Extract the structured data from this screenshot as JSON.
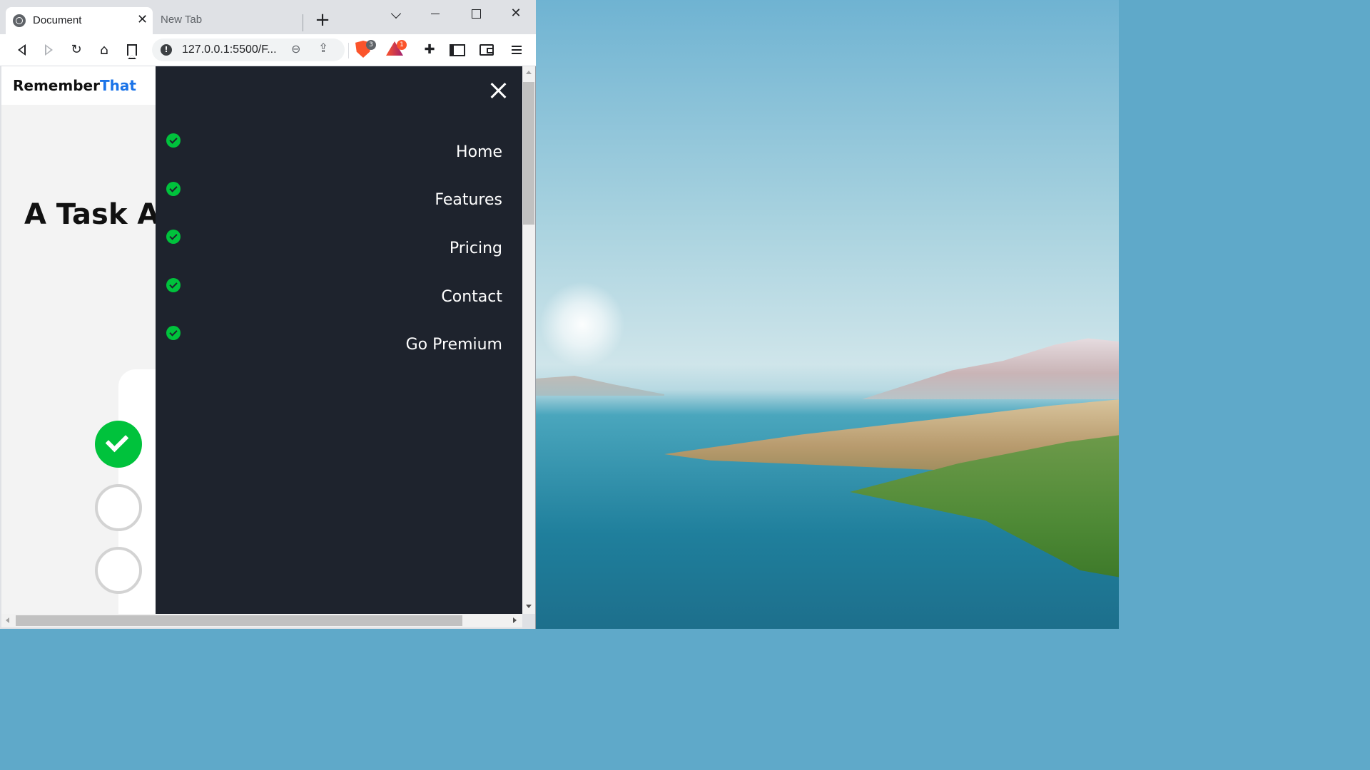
{
  "browser": {
    "tabs": [
      {
        "title": "Document",
        "active": true
      },
      {
        "title": "New Tab",
        "active": false
      }
    ],
    "close_tab_glyph": "✕",
    "new_tab_glyph": "+",
    "url": "127.0.0.1:5500/F...",
    "info_glyph": "!",
    "shields_badge": "3",
    "rewards_badge": "1",
    "window_close_glyph": "✕"
  },
  "page": {
    "logo_prefix": "Remember",
    "logo_accent": "That",
    "hero_title": "A Task A",
    "steps": [
      {
        "state": "done"
      },
      {
        "state": "todo"
      },
      {
        "state": "todo"
      }
    ],
    "nav": {
      "items": [
        {
          "label": "Home"
        },
        {
          "label": "Features"
        },
        {
          "label": "Pricing"
        },
        {
          "label": "Contact"
        },
        {
          "label": "Go Premium"
        }
      ]
    }
  },
  "colors": {
    "accent_blue": "#1a73e8",
    "check_green": "#00c23c",
    "nav_bg": "#1e232d",
    "brave_orange": "#fb542b"
  },
  "icons": {
    "tab_favicon": "globe-icon",
    "back": "back-arrow-icon",
    "forward": "forward-arrow-icon",
    "reload": "reload-icon",
    "home": "home-icon",
    "bookmark": "bookmark-icon",
    "site_info": "info-icon",
    "zoom": "zoom-out-icon",
    "share": "share-icon",
    "shields": "brave-shields-icon",
    "rewards": "brave-rewards-icon",
    "extensions": "puzzle-icon",
    "sidebar": "sidebar-icon",
    "wallet": "wallet-icon",
    "menu": "hamburger-menu-icon",
    "nav_close": "close-icon",
    "nav_check": "check-circle-icon"
  }
}
